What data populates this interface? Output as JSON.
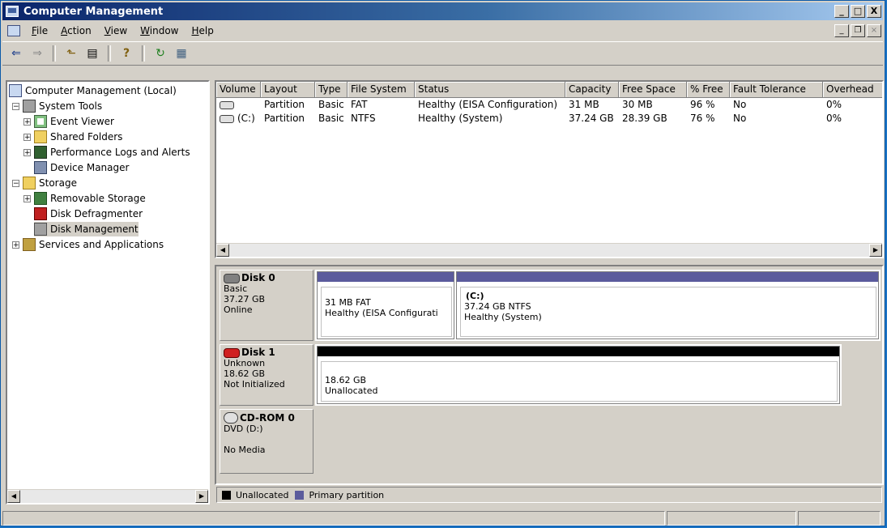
{
  "window": {
    "title": "Computer Management",
    "controls": {
      "minimize": "_",
      "maximize": "□",
      "close": "X"
    }
  },
  "menubar": {
    "items": [
      "File",
      "Action",
      "View",
      "Window",
      "Help"
    ],
    "mdi_controls": {
      "minimize": "_",
      "restore": "❐",
      "close": "×"
    }
  },
  "toolbar": {
    "icons": [
      "back-arrow-icon",
      "forward-arrow-icon",
      "up-folder-icon",
      "show-hide-tree-icon",
      "help-icon",
      "refresh-icon",
      "export-list-icon"
    ],
    "glyphs": {
      "back": "⇐",
      "forward": "⇒",
      "up": "⬑",
      "tree": "▤",
      "help": "?",
      "refresh": "↻",
      "export": "▦"
    }
  },
  "tree": {
    "root": "Computer Management (Local)",
    "system_tools": "System Tools",
    "event_viewer": "Event Viewer",
    "shared_folders": "Shared Folders",
    "perf_logs": "Performance Logs and Alerts",
    "device_manager": "Device Manager",
    "storage": "Storage",
    "removable_storage": "Removable Storage",
    "disk_defragmenter": "Disk Defragmenter",
    "disk_management": "Disk Management",
    "services_apps": "Services and Applications",
    "expand_minus": "−",
    "expand_plus": "+"
  },
  "volume_list": {
    "columns": [
      "Volume",
      "Layout",
      "Type",
      "File System",
      "Status",
      "Capacity",
      "Free Space",
      "% Free",
      "Fault Tolerance",
      "Overhead"
    ],
    "rows": [
      {
        "volume": "",
        "layout": "Partition",
        "type": "Basic",
        "fs": "FAT",
        "status": "Healthy (EISA Configuration)",
        "capacity": "31 MB",
        "free": "30 MB",
        "pct_free": "96 %",
        "fault": "No",
        "overhead": "0%"
      },
      {
        "volume": "(C:)",
        "layout": "Partition",
        "type": "Basic",
        "fs": "NTFS",
        "status": "Healthy (System)",
        "capacity": "37.24 GB",
        "free": "28.39 GB",
        "pct_free": "76 %",
        "fault": "No",
        "overhead": "0%"
      }
    ]
  },
  "disks": [
    {
      "name": "Disk 0",
      "type": "Basic",
      "size": "37.27 GB",
      "state": "Online",
      "partitions": [
        {
          "title": "",
          "size_fs": "31 MB FAT",
          "status": "Healthy (EISA Configurati"
        },
        {
          "title": "(C:)",
          "size_fs": "37.24 GB NTFS",
          "status": "Healthy (System)"
        }
      ]
    },
    {
      "name": "Disk 1",
      "type": "Unknown",
      "size": "18.62 GB",
      "state": "Not Initialized",
      "partitions": [
        {
          "title": "",
          "size_fs": "18.62 GB",
          "status": "Unallocated"
        }
      ]
    },
    {
      "name": "CD-ROM 0",
      "type": "DVD (D:)",
      "size": "",
      "state": "No Media"
    }
  ],
  "legend": {
    "unallocated": "Unallocated",
    "primary": "Primary partition"
  },
  "colors": {
    "primary_partition": "#5b5b9c",
    "unallocated": "#000000",
    "title_gradient_start": "#0a246a",
    "title_gradient_end": "#a6caf0"
  }
}
